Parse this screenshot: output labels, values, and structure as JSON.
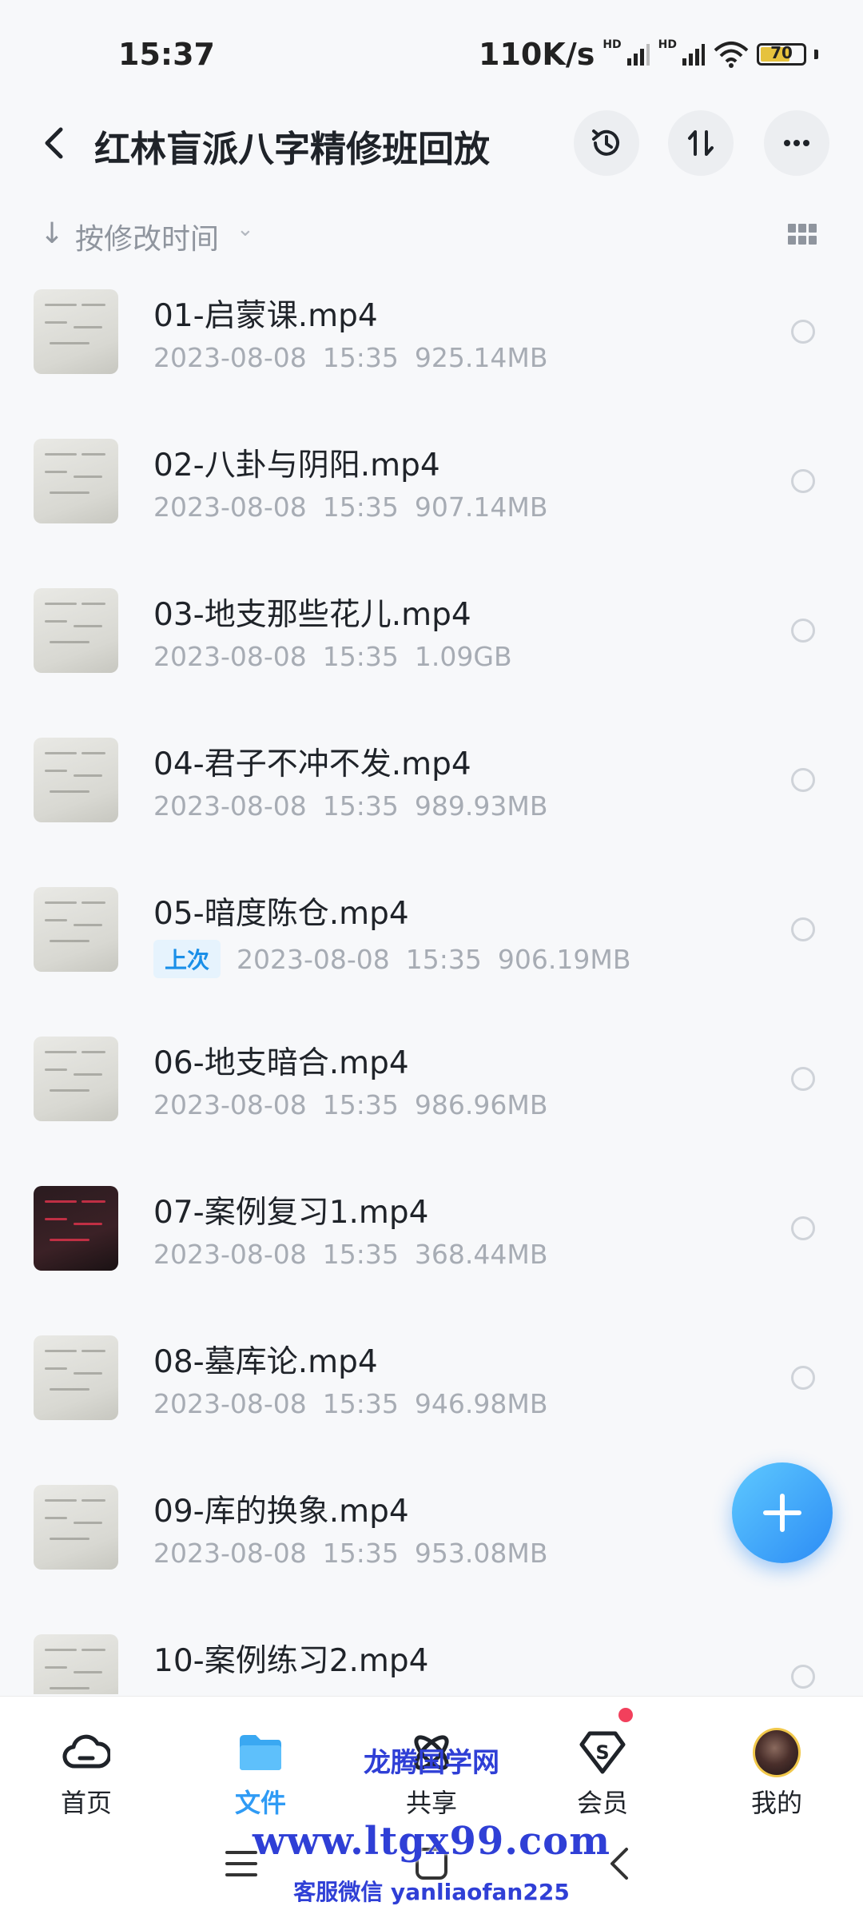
{
  "status_bar": {
    "time": "15:37",
    "net_speed": "110K/s",
    "hd_1": "HD",
    "hd_2": "HD",
    "battery": "70"
  },
  "header": {
    "title": "红林盲派八字精修班回放"
  },
  "sort": {
    "label": "按修改时间"
  },
  "files": [
    {
      "name": "01-启蒙课.mp4",
      "date": "2023-08-08",
      "time": "15:35",
      "size": "925.14MB",
      "badge": "",
      "thumb": "light"
    },
    {
      "name": "02-八卦与阴阳.mp4",
      "date": "2023-08-08",
      "time": "15:35",
      "size": "907.14MB",
      "badge": "",
      "thumb": "light"
    },
    {
      "name": "03-地支那些花儿.mp4",
      "date": "2023-08-08",
      "time": "15:35",
      "size": "1.09GB",
      "badge": "",
      "thumb": "light"
    },
    {
      "name": "04-君子不冲不发.mp4",
      "date": "2023-08-08",
      "time": "15:35",
      "size": "989.93MB",
      "badge": "",
      "thumb": "light"
    },
    {
      "name": "05-暗度陈仓.mp4",
      "date": "2023-08-08",
      "time": "15:35",
      "size": "906.19MB",
      "badge": "上次",
      "thumb": "light"
    },
    {
      "name": "06-地支暗合.mp4",
      "date": "2023-08-08",
      "time": "15:35",
      "size": "986.96MB",
      "badge": "",
      "thumb": "light"
    },
    {
      "name": "07-案例复习1.mp4",
      "date": "2023-08-08",
      "time": "15:35",
      "size": "368.44MB",
      "badge": "",
      "thumb": "dark"
    },
    {
      "name": "08-墓库论.mp4",
      "date": "2023-08-08",
      "time": "15:35",
      "size": "946.98MB",
      "badge": "",
      "thumb": "light"
    },
    {
      "name": "09-库的换象.mp4",
      "date": "2023-08-08",
      "time": "15:35",
      "size": "953.08MB",
      "badge": "",
      "thumb": "light"
    },
    {
      "name": "10-案例练习2.mp4",
      "date": "",
      "time": "",
      "size": "",
      "badge": "",
      "thumb": "light"
    }
  ],
  "bottom_nav": [
    {
      "label": "首页",
      "icon": "cloud-icon",
      "active": false
    },
    {
      "label": "文件",
      "icon": "folder-icon",
      "active": true
    },
    {
      "label": "共享",
      "icon": "atom-icon",
      "active": false
    },
    {
      "label": "会员",
      "icon": "vip-diamond-icon",
      "active": false,
      "dot": true
    },
    {
      "label": "我的",
      "icon": "avatar",
      "active": false
    }
  ],
  "watermark": {
    "site_name": "龙腾国学网",
    "url": "www.ltgx99.com",
    "contact": "客服微信 yanliaofan225"
  },
  "colors": {
    "accent": "#2f9bf5",
    "badge_bg": "#e6f3fd",
    "badge_text": "#1a8fe8",
    "meta_text": "#a7acb4",
    "notification_dot": "#f2405c"
  }
}
